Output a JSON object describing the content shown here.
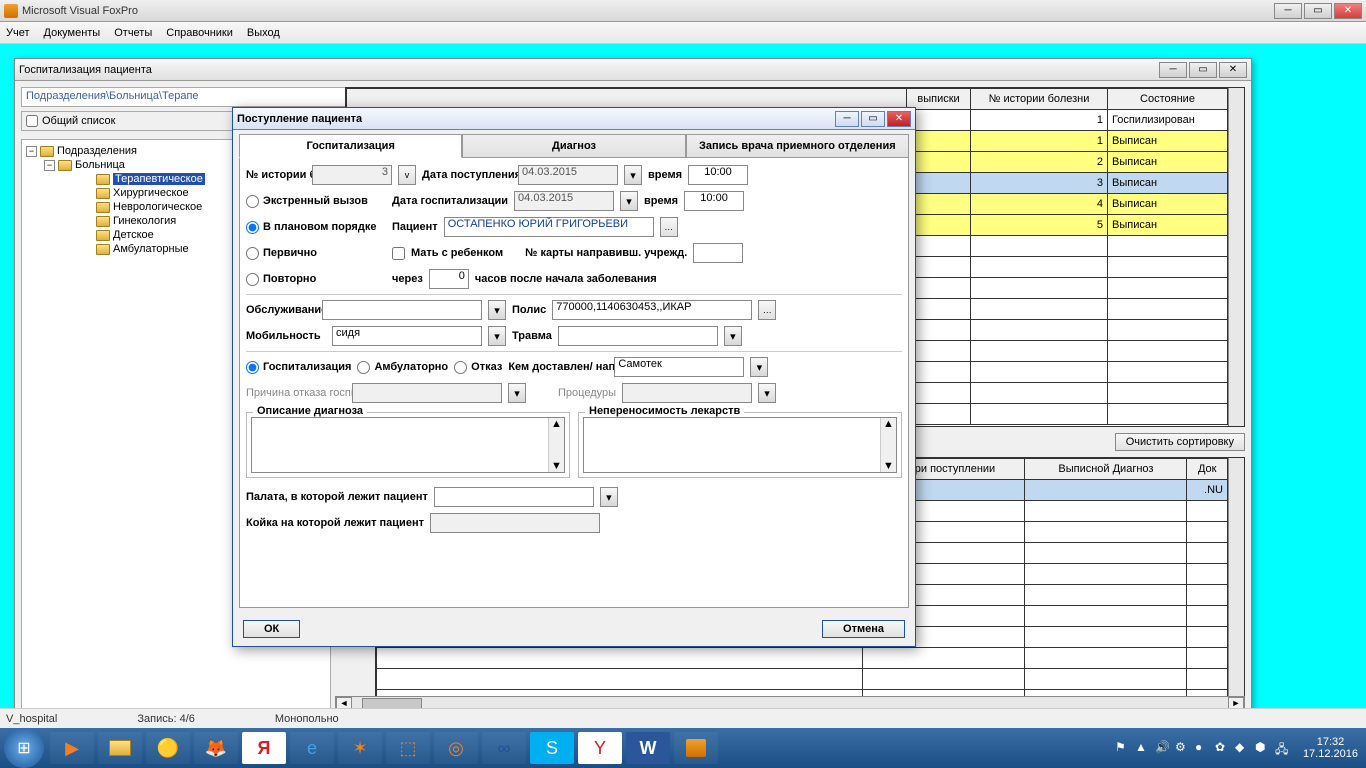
{
  "app": {
    "title": "Microsoft Visual FoxPro"
  },
  "menu": [
    "Учет",
    "Документы",
    "Отчеты",
    "Справочники",
    "Выход"
  ],
  "childWindow": {
    "title": "Госпитализация пациента",
    "path": "Подразделения\\Больница\\Терапе",
    "listHeader": "Общий список"
  },
  "tree": {
    "root": "Подразделения",
    "hospital": "Больница",
    "departments": [
      "Терапевтическое",
      "Хирургическое",
      "Неврологическое",
      "Гинекология",
      "Детское",
      "Амбулаторные"
    ]
  },
  "upperGrid": {
    "cols": [
      "выписки",
      "№ истории болезни",
      "Состояние"
    ],
    "rows": [
      {
        "num": "1",
        "state": "Госпилизирован",
        "cls": ""
      },
      {
        "num": "1",
        "state": "Выписан",
        "cls": "yellow"
      },
      {
        "num": "2",
        "state": "Выписан",
        "cls": "yellow"
      },
      {
        "num": "3",
        "state": "Выписан",
        "cls": "blue"
      },
      {
        "num": "4",
        "state": "Выписан",
        "cls": "yellow"
      },
      {
        "num": "5",
        "state": "Выписан",
        "cls": "yellow"
      }
    ]
  },
  "clearSort": "Очистить сортировку",
  "lowerGrid": {
    "cols": [
      "юз при поступлении",
      "Выписной Диагноз",
      "Док"
    ],
    "cell": ".NU"
  },
  "dialog": {
    "title": "Поступление пациента",
    "tabs": [
      "Госпитализация",
      "Диагноз",
      "Запись врача приемного отделения"
    ],
    "labels": {
      "historyNo": "№ истории болезни",
      "historyVal": "3",
      "vBtn": "v",
      "admDate": "Дата поступления",
      "admDateVal": "04.03.2015",
      "time": "время",
      "timeVal": "10:00",
      "emergency": "Экстренный вызов",
      "planned": "В плановом порядке",
      "hospDate": "Дата госпитализации",
      "hospDateVal": "04.03.2015",
      "hospTime": "10:00",
      "patient": "Пациент",
      "patientName": "ОСТАПЕНКО ЮРИЙ ГРИГОРЬЕВИ",
      "primary": "Первично",
      "repeat": "Повторно",
      "motherChild": "Мать с ребенком",
      "refCard": "№ карты направивш. учрежд.",
      "after": "через",
      "afterVal": "0",
      "afterUnits": "часов после начала заболевания",
      "service": "Обслуживание",
      "policy": "Полис",
      "policyVal": "770000,1140630453,,ИКАР",
      "mobility": "Мобильность",
      "mobilityVal": "сидя",
      "trauma": "Травма",
      "hosp": "Госпитализация",
      "amb": "Амбулаторно",
      "refuse": "Отказ",
      "deliveredBy": "Кем доставлен/ направлен",
      "deliveredVal": "Самотек",
      "refuseReason": "Причина отказа госпитализации",
      "procedures": "Процедуры",
      "diagDesc": "Описание диагноза",
      "intolerance": "Непереносимость лекарств",
      "ward": "Палата, в которой лежит пациент",
      "bed": "Койка на которой лежит пациент"
    },
    "buttons": {
      "ok": "ОК",
      "cancel": "Отмена"
    }
  },
  "status": {
    "left": "V_hospital",
    "record": "Запись: 4/6",
    "mode": "Монопольно"
  },
  "tray": {
    "time": "17:32",
    "date": "17.12.2016"
  }
}
